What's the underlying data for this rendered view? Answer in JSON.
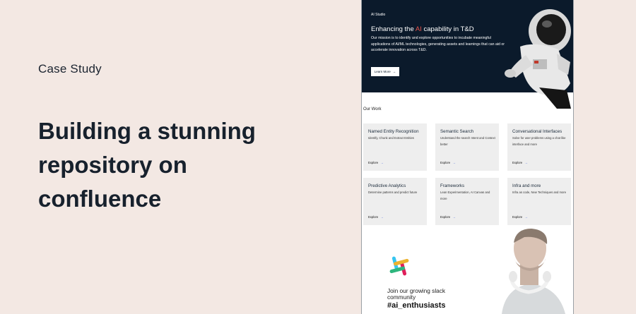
{
  "left": {
    "eyebrow": "Case Study",
    "headline": "Building a stunning repository on confluence"
  },
  "page": {
    "brand": "AI Studio",
    "hero": {
      "title_before": "Enhancing the ",
      "title_highlight": "AI",
      "title_after": " capability in T&D",
      "description": "Our mission is to identify and explore opportunities to incubate meaningful applications of AI/ML technologies, generating assets and learnings that can aid or accelerate innovation across T&D.",
      "button_label": "Learn More",
      "highlight_color": "#e8534a",
      "background_color": "#0b1a2b"
    },
    "our_work": {
      "title": "Our Work",
      "cards": [
        {
          "title": "Named Entity Recognition",
          "desc": "Identify, Chunk and Extract Entities",
          "cta": "Explore"
        },
        {
          "title": "Semantic Search",
          "desc": "Understand the search Intent and Context better",
          "cta": "Explore"
        },
        {
          "title": "Conversational Interfaces",
          "desc": "Solve for user problems using a chat like interface and more",
          "cta": "Explore"
        },
        {
          "title": "Predictive Analytics",
          "desc": "Determine patterns and predict future",
          "cta": "Explore"
        },
        {
          "title": "Frameworks",
          "desc": "Lean Experimentation, AI Canvas and more",
          "cta": "Explore"
        },
        {
          "title": "Infra and more",
          "desc": "Infra as code, New Techniques and more",
          "cta": "Explore"
        }
      ]
    },
    "slack": {
      "line1": "Join our growing slack",
      "line2": "community",
      "tag": "#ai_enthusiasts"
    }
  },
  "icons": [
    "arrow-right-icon",
    "slack-logo-icon",
    "astronaut-image",
    "person-headphones-image"
  ]
}
